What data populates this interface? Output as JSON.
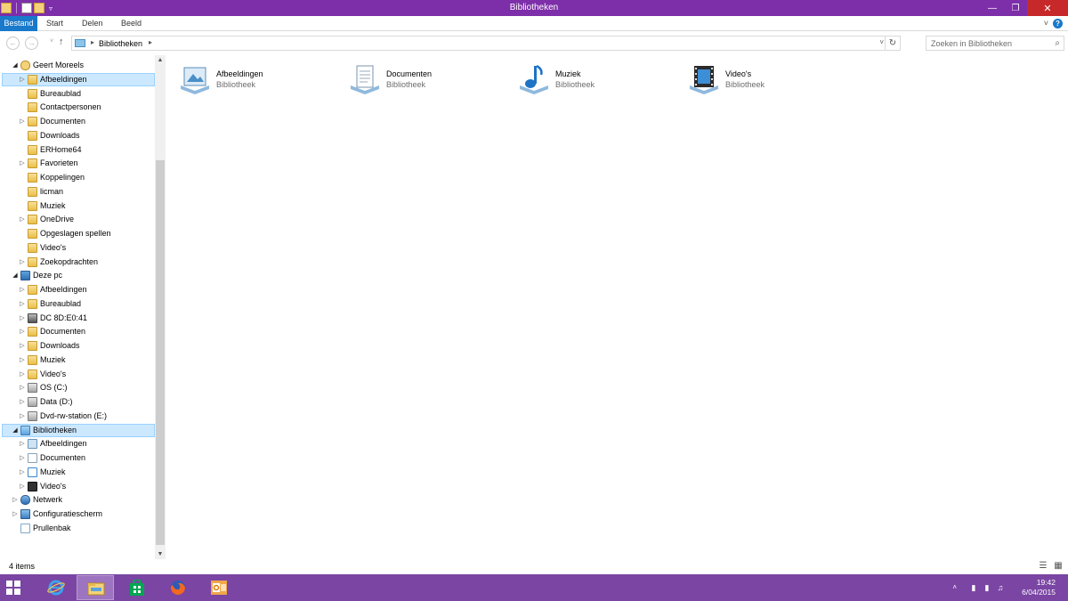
{
  "window": {
    "title": "Bibliotheken",
    "controls": {
      "minimize": "—",
      "maximize": "❐",
      "close": "✕"
    }
  },
  "ribbon": {
    "tabs": [
      {
        "label": "Bestand",
        "active": true
      },
      {
        "label": "Start"
      },
      {
        "label": "Delen"
      },
      {
        "label": "Beeld"
      }
    ],
    "expand_glyph": "˅",
    "help_glyph": "?"
  },
  "navigation": {
    "back_glyph": "←",
    "forward_glyph": "→",
    "recent_glyph": "˅",
    "up_glyph": "↑",
    "address": {
      "crumbs": [
        "Bibliotheken"
      ],
      "separator": "▸",
      "dropdown_glyph": "˅",
      "refresh_glyph": "↻"
    },
    "search": {
      "placeholder": "Zoeken in Bibliotheken",
      "icon": "search-icon",
      "glyph": "⌕"
    }
  },
  "tree": [
    {
      "label": "Geert Moreels",
      "level": 0,
      "expanded": true,
      "icon": "user"
    },
    {
      "label": "Afbeeldingen",
      "level": 1,
      "expandable": true,
      "icon": "folder",
      "selected": true
    },
    {
      "label": "Bureaublad",
      "level": 1,
      "icon": "folder"
    },
    {
      "label": "Contactpersonen",
      "level": 1,
      "icon": "folder"
    },
    {
      "label": "Documenten",
      "level": 1,
      "expandable": true,
      "icon": "folder"
    },
    {
      "label": "Downloads",
      "level": 1,
      "icon": "folder"
    },
    {
      "label": "ERHome64",
      "level": 1,
      "icon": "folder"
    },
    {
      "label": "Favorieten",
      "level": 1,
      "expandable": true,
      "icon": "folder"
    },
    {
      "label": "Koppelingen",
      "level": 1,
      "icon": "folder"
    },
    {
      "label": "licman",
      "level": 1,
      "icon": "folder"
    },
    {
      "label": "Muziek",
      "level": 1,
      "icon": "folder"
    },
    {
      "label": "OneDrive",
      "level": 1,
      "expandable": true,
      "icon": "folder"
    },
    {
      "label": "Opgeslagen spellen",
      "level": 1,
      "icon": "folder"
    },
    {
      "label": "Video's",
      "level": 1,
      "icon": "folder"
    },
    {
      "label": "Zoekopdrachten",
      "level": 1,
      "expandable": true,
      "icon": "folder"
    },
    {
      "label": "Deze pc",
      "level": 0,
      "expanded": true,
      "icon": "pc"
    },
    {
      "label": "Afbeeldingen",
      "level": 1,
      "expandable": true,
      "icon": "folder"
    },
    {
      "label": "Bureaublad",
      "level": 1,
      "expandable": true,
      "icon": "folder"
    },
    {
      "label": "DC 8D:E0:41",
      "level": 1,
      "expandable": true,
      "icon": "phone"
    },
    {
      "label": "Documenten",
      "level": 1,
      "expandable": true,
      "icon": "folder"
    },
    {
      "label": "Downloads",
      "level": 1,
      "expandable": true,
      "icon": "folder"
    },
    {
      "label": "Muziek",
      "level": 1,
      "expandable": true,
      "icon": "folder"
    },
    {
      "label": "Video's",
      "level": 1,
      "expandable": true,
      "icon": "folder"
    },
    {
      "label": "OS (C:)",
      "level": 1,
      "expandable": true,
      "icon": "drive"
    },
    {
      "label": "Data (D:)",
      "level": 1,
      "expandable": true,
      "icon": "drive"
    },
    {
      "label": "Dvd-rw-station (E:)",
      "level": 1,
      "expandable": true,
      "icon": "drive"
    },
    {
      "label": "Bibliotheken",
      "level": 0,
      "expanded": true,
      "icon": "library",
      "current": true
    },
    {
      "label": "Afbeeldingen",
      "level": 1,
      "expandable": true,
      "icon": "pic"
    },
    {
      "label": "Documenten",
      "level": 1,
      "expandable": true,
      "icon": "doc"
    },
    {
      "label": "Muziek",
      "level": 1,
      "expandable": true,
      "icon": "music"
    },
    {
      "label": "Video's",
      "level": 1,
      "expandable": true,
      "icon": "video"
    },
    {
      "label": "Netwerk",
      "level": 0,
      "expandable": true,
      "icon": "net"
    },
    {
      "label": "Configuratiescherm",
      "level": 0,
      "expandable": true,
      "icon": "cp"
    },
    {
      "label": "Prullenbak",
      "level": 0,
      "icon": "bin"
    }
  ],
  "libraries": [
    {
      "name": "Afbeeldingen",
      "type": "Bibliotheek",
      "icon": "pictures-library-icon"
    },
    {
      "name": "Documenten",
      "type": "Bibliotheek",
      "icon": "documents-library-icon"
    },
    {
      "name": "Muziek",
      "type": "Bibliotheek",
      "icon": "music-library-icon"
    },
    {
      "name": "Video's",
      "type": "Bibliotheek",
      "icon": "videos-library-icon"
    }
  ],
  "status": {
    "item_count": "4 items"
  },
  "taskbar": {
    "apps": [
      {
        "name": "internet-explorer",
        "active": false
      },
      {
        "name": "file-explorer",
        "active": true
      },
      {
        "name": "store",
        "active": false
      },
      {
        "name": "firefox",
        "active": false
      },
      {
        "name": "outlook",
        "active": false
      }
    ],
    "clock": {
      "time": "19:42",
      "date": "6/04/2015"
    },
    "tray_caret": "˄"
  }
}
